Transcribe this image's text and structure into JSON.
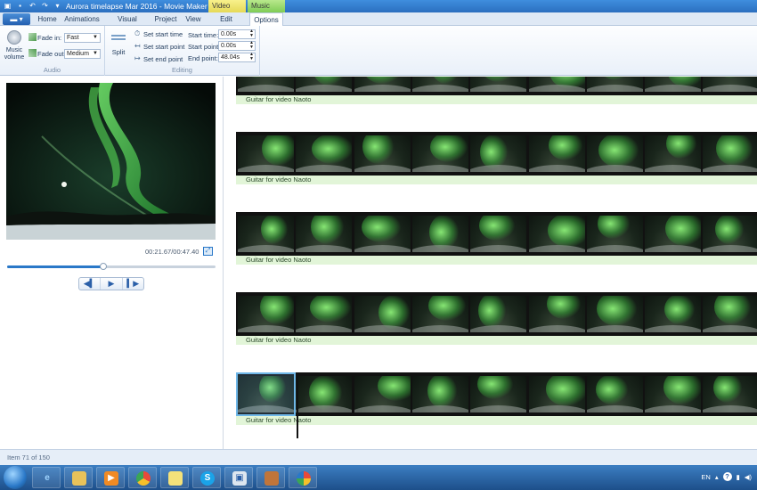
{
  "window": {
    "title": "Aurora timelapse Mar 2016 - Movie Maker",
    "contextual_tabs": [
      "Video Tools",
      "Music Tools"
    ]
  },
  "tabs": {
    "file_label": "",
    "items": [
      "Home",
      "Animations",
      "Visual Effects",
      "Project",
      "View",
      "Edit",
      "Options"
    ],
    "active": "Options"
  },
  "ribbon": {
    "audio": {
      "music_volume_label": "Music volume",
      "fade_in_label": "Fade in:",
      "fade_in_value": "Fast",
      "fade_out_label": "Fade out:",
      "fade_out_value": "Medium",
      "group_label": "Audio"
    },
    "editing": {
      "split_label": "Split",
      "set_start_time": "Set start time",
      "set_start_point": "Set start point",
      "set_end_point": "Set end point",
      "start_time_label": "Start time:",
      "start_time_value": "0.00s",
      "start_point_label": "Start point:",
      "start_point_value": "0.00s",
      "end_point_label": "End point:",
      "end_point_value": "48.04s",
      "group_label": "Editing"
    }
  },
  "preview": {
    "time_readout": "00:21.67/00:47.40",
    "seek_progress": 0.46
  },
  "storyboard": {
    "audio_labels": [
      "Guitar for video Naoto",
      "Guitar for video Naoto",
      "Guitar for video Naoto",
      "Guitar for video Naoto",
      "Guitar for video Naoto"
    ]
  },
  "status": {
    "item_text": "Item 71 of 150"
  },
  "taskbar": {
    "language": "EN"
  }
}
